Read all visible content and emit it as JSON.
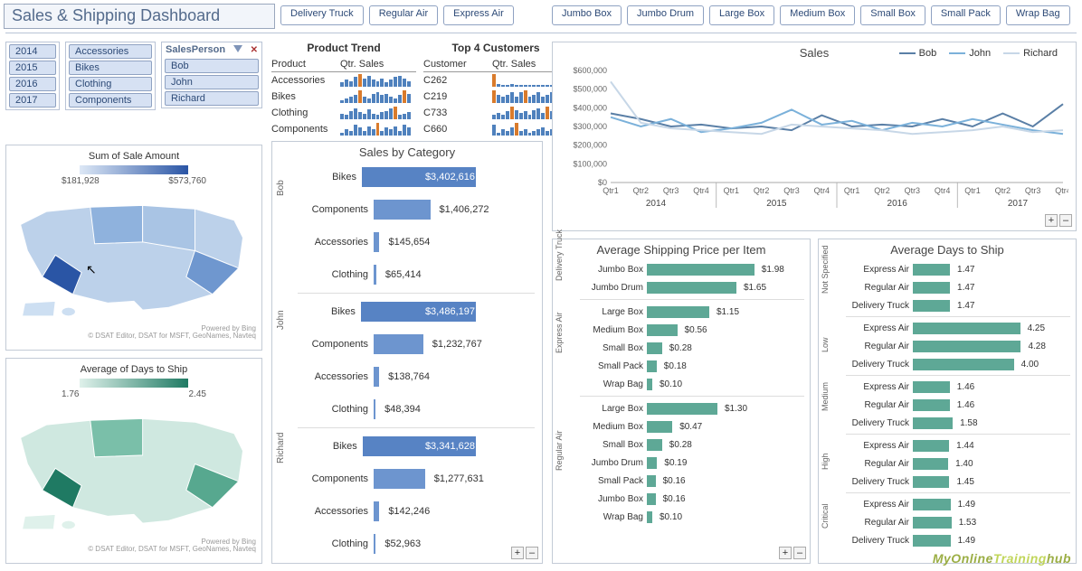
{
  "title": "Sales & Shipping Dashboard",
  "top_slicers_shipmode": [
    "Delivery Truck",
    "Regular Air",
    "Express Air"
  ],
  "top_slicers_container": [
    "Jumbo Box",
    "Jumbo Drum",
    "Large Box",
    "Medium Box",
    "Small Box",
    "Small Pack",
    "Wrap Bag"
  ],
  "year_slicer": [
    "2014",
    "2015",
    "2016",
    "2017"
  ],
  "category_slicer": [
    "Accessories",
    "Bikes",
    "Clothing",
    "Components"
  ],
  "salesperson_slicer_title": "SalesPerson",
  "salesperson_slicer": [
    "Bob",
    "John",
    "Richard"
  ],
  "product_trend": {
    "title": "Product Trend",
    "headers": [
      "Product",
      "Qtr. Sales"
    ],
    "rows": [
      {
        "product": "Accessories",
        "spark": [
          3,
          5,
          4,
          7,
          9,
          6,
          8,
          5,
          4,
          6,
          3,
          5,
          7,
          8,
          6,
          4
        ]
      },
      {
        "product": "Bikes",
        "spark": [
          2,
          3,
          4,
          5,
          8,
          4,
          3,
          6,
          7,
          5,
          6,
          4,
          3,
          5,
          8,
          6
        ]
      },
      {
        "product": "Clothing",
        "spark": [
          4,
          3,
          6,
          8,
          5,
          4,
          7,
          4,
          3,
          5,
          6,
          8,
          9,
          3,
          4,
          5
        ]
      },
      {
        "product": "Components",
        "spark": [
          2,
          4,
          3,
          7,
          5,
          3,
          6,
          4,
          8,
          3,
          5,
          4,
          6,
          3,
          7,
          5
        ]
      }
    ]
  },
  "top4_customers": {
    "title": "Top 4 Customers",
    "headers": [
      "Customer",
      "Qtr. Sales"
    ],
    "rows": [
      {
        "customer": "C262",
        "spark": [
          8,
          2,
          1,
          1,
          2,
          1,
          1,
          1,
          1,
          1,
          1,
          1,
          1,
          1,
          1,
          1
        ]
      },
      {
        "customer": "C219",
        "spark": [
          6,
          4,
          3,
          4,
          5,
          3,
          5,
          6,
          3,
          4,
          5,
          3,
          4,
          5,
          3,
          4
        ]
      },
      {
        "customer": "C733",
        "spark": [
          3,
          4,
          3,
          5,
          8,
          6,
          4,
          5,
          3,
          6,
          7,
          4,
          8,
          5,
          6,
          4
        ]
      },
      {
        "customer": "C660",
        "spark": [
          7,
          2,
          4,
          3,
          5,
          8,
          3,
          4,
          2,
          3,
          4,
          5,
          3,
          4,
          5,
          6
        ]
      }
    ]
  },
  "map_sales": {
    "title": "Sum of Sale Amount",
    "min": "$181,928",
    "max": "$573,760",
    "credit1": "Powered by Bing",
    "credit2": "© DSAT Editor, DSAT for MSFT, GeoNames, Navteq"
  },
  "map_days": {
    "title": "Average of Days to Ship",
    "min": "1.76",
    "max": "2.45",
    "credit1": "Powered by Bing",
    "credit2": "© DSAT Editor, DSAT for MSFT, GeoNames, Navteq"
  },
  "chart_data": [
    {
      "id": "sales_by_category",
      "type": "bar",
      "title": "Sales by Category",
      "orientation": "horizontal",
      "x_scale_max": 3600000,
      "groups": [
        {
          "person": "Bob",
          "rows": [
            {
              "category": "Bikes",
              "value": 3402616,
              "label": "$3,402,616"
            },
            {
              "category": "Components",
              "value": 1406272,
              "label": "$1,406,272"
            },
            {
              "category": "Accessories",
              "value": 145654,
              "label": "$145,654"
            },
            {
              "category": "Clothing",
              "value": 65414,
              "label": "$65,414"
            }
          ]
        },
        {
          "person": "John",
          "rows": [
            {
              "category": "Bikes",
              "value": 3486197,
              "label": "$3,486,197"
            },
            {
              "category": "Components",
              "value": 1232767,
              "label": "$1,232,767"
            },
            {
              "category": "Accessories",
              "value": 138764,
              "label": "$138,764"
            },
            {
              "category": "Clothing",
              "value": 48394,
              "label": "$48,394"
            }
          ]
        },
        {
          "person": "Richard",
          "rows": [
            {
              "category": "Bikes",
              "value": 3341628,
              "label": "$3,341,628"
            },
            {
              "category": "Components",
              "value": 1277631,
              "label": "$1,277,631"
            },
            {
              "category": "Accessories",
              "value": 142246,
              "label": "$142,246"
            },
            {
              "category": "Clothing",
              "value": 52963,
              "label": "$52,963"
            }
          ]
        }
      ]
    },
    {
      "id": "sales_line",
      "type": "line",
      "title": "Sales",
      "ylim": [
        0,
        600000
      ],
      "yticks": [
        "$0",
        "$100,000",
        "$200,000",
        "$300,000",
        "$400,000",
        "$500,000",
        "$600,000"
      ],
      "x": [
        "Qtr1",
        "Qtr2",
        "Qtr3",
        "Qtr4",
        "Qtr1",
        "Qtr2",
        "Qtr3",
        "Qtr4",
        "Qtr1",
        "Qtr2",
        "Qtr3",
        "Qtr4",
        "Qtr1",
        "Qtr2",
        "Qtr3",
        "Qtr4"
      ],
      "x_groups": [
        "2014",
        "2015",
        "2016",
        "2017"
      ],
      "series": [
        {
          "name": "Bob",
          "color": "#5a7fa6",
          "values": [
            370000,
            340000,
            300000,
            310000,
            290000,
            300000,
            280000,
            360000,
            300000,
            310000,
            300000,
            340000,
            300000,
            370000,
            300000,
            420000
          ]
        },
        {
          "name": "John",
          "color": "#7bb1da",
          "values": [
            350000,
            300000,
            340000,
            270000,
            290000,
            320000,
            390000,
            310000,
            330000,
            280000,
            320000,
            300000,
            340000,
            310000,
            280000,
            260000
          ]
        },
        {
          "name": "Richard",
          "color": "#c7d7e7",
          "values": [
            540000,
            320000,
            290000,
            280000,
            270000,
            260000,
            310000,
            300000,
            290000,
            280000,
            260000,
            270000,
            280000,
            300000,
            270000,
            280000
          ]
        }
      ]
    },
    {
      "id": "avg_shipping_price",
      "type": "bar",
      "title": "Average Shipping Price per Item",
      "orientation": "horizontal",
      "x_scale_max": 2.0,
      "groups": [
        {
          "mode": "Delivery Truck",
          "rows": [
            {
              "container": "Jumbo Box",
              "value": 1.98,
              "label": "$1.98"
            },
            {
              "container": "Jumbo Drum",
              "value": 1.65,
              "label": "$1.65"
            }
          ]
        },
        {
          "mode": "Express Air",
          "rows": [
            {
              "container": "Large Box",
              "value": 1.15,
              "label": "$1.15"
            },
            {
              "container": "Medium Box",
              "value": 0.56,
              "label": "$0.56"
            },
            {
              "container": "Small Box",
              "value": 0.28,
              "label": "$0.28"
            },
            {
              "container": "Small Pack",
              "value": 0.18,
              "label": "$0.18"
            },
            {
              "container": "Wrap Bag",
              "value": 0.1,
              "label": "$0.10"
            }
          ]
        },
        {
          "mode": "Regular Air",
          "rows": [
            {
              "container": "Large Box",
              "value": 1.3,
              "label": "$1.30"
            },
            {
              "container": "Medium Box",
              "value": 0.47,
              "label": "$0.47"
            },
            {
              "container": "Small Box",
              "value": 0.28,
              "label": "$0.28"
            },
            {
              "container": "Jumbo Drum",
              "value": 0.19,
              "label": "$0.19"
            },
            {
              "container": "Small Pack",
              "value": 0.16,
              "label": "$0.16"
            },
            {
              "container": "Jumbo Box",
              "value": 0.16,
              "label": "$0.16"
            },
            {
              "container": "Wrap Bag",
              "value": 0.1,
              "label": "$0.10"
            }
          ]
        }
      ]
    },
    {
      "id": "avg_days_to_ship",
      "type": "bar",
      "title": "Average Days to Ship",
      "orientation": "horizontal",
      "x_scale_max": 4.3,
      "groups": [
        {
          "priority": "Not Specified",
          "rows": [
            {
              "mode": "Express Air",
              "value": 1.47,
              "label": "1.47"
            },
            {
              "mode": "Regular Air",
              "value": 1.47,
              "label": "1.47"
            },
            {
              "mode": "Delivery Truck",
              "value": 1.47,
              "label": "1.47"
            }
          ]
        },
        {
          "priority": "Low",
          "rows": [
            {
              "mode": "Express Air",
              "value": 4.25,
              "label": "4.25"
            },
            {
              "mode": "Regular Air",
              "value": 4.28,
              "label": "4.28"
            },
            {
              "mode": "Delivery Truck",
              "value": 4.0,
              "label": "4.00"
            }
          ]
        },
        {
          "priority": "Medium",
          "rows": [
            {
              "mode": "Express Air",
              "value": 1.46,
              "label": "1.46"
            },
            {
              "mode": "Regular Air",
              "value": 1.46,
              "label": "1.46"
            },
            {
              "mode": "Delivery Truck",
              "value": 1.58,
              "label": "1.58"
            }
          ]
        },
        {
          "priority": "High",
          "rows": [
            {
              "mode": "Express Air",
              "value": 1.44,
              "label": "1.44"
            },
            {
              "mode": "Regular Air",
              "value": 1.4,
              "label": "1.40"
            },
            {
              "mode": "Delivery Truck",
              "value": 1.45,
              "label": "1.45"
            }
          ]
        },
        {
          "priority": "Critical",
          "rows": [
            {
              "mode": "Express Air",
              "value": 1.49,
              "label": "1.49"
            },
            {
              "mode": "Regular Air",
              "value": 1.53,
              "label": "1.53"
            },
            {
              "mode": "Delivery Truck",
              "value": 1.49,
              "label": "1.49"
            }
          ]
        }
      ]
    }
  ],
  "watermark": {
    "a": "MyOnline",
    "b": "Training",
    "c": "hub"
  },
  "plus": "+",
  "minus": "–"
}
